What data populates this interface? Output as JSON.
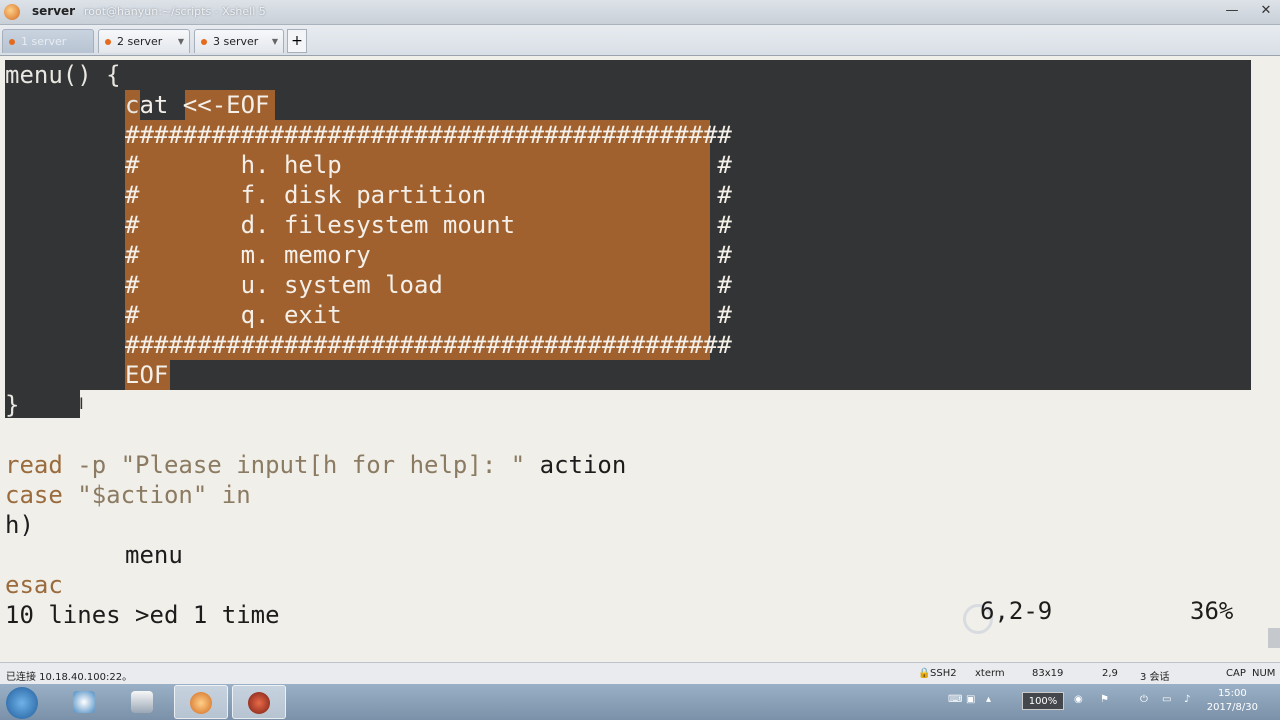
{
  "window": {
    "title": "server",
    "path": "root@hanyun:~/scripts - Xshell 5",
    "minimize_label": "—",
    "maximize_label": "▢",
    "close_label": "✕"
  },
  "tabs": [
    {
      "label": "1 server"
    },
    {
      "label": "2 server"
    },
    {
      "label": "3 server"
    }
  ],
  "tab_add_label": "+",
  "terminal": {
    "line1": "menu() {",
    "line2_c": "c",
    "line2_rest": "at <<-EOF",
    "line3": "##########################################",
    "line4": "#       h. help                          #",
    "line5": "#       f. disk partition                #",
    "line6": "#       d. filesystem mount              #",
    "line7": "#       m. memory                        #",
    "line8": "#       u. system load                   #",
    "line9": "#       q. exit                          #",
    "line10": "##########################################",
    "line11": "EOF",
    "line12": "}",
    "line14_kw": "read",
    "line14_opt": " -p ",
    "line14_str": "\"Please input[h for help]: \"",
    "line14_var": " action",
    "line15_kw": "case",
    "line15_str": " \"$action\"",
    "line15_in": " in",
    "line16": "h)",
    "line17": "menu",
    "line18": "esac",
    "status_msg": "10 lines >ed 1 time",
    "position": "6,2-9",
    "percent": "36%"
  },
  "statusbar": {
    "connection": "已连接 10.18.40.100:22。",
    "protocol": "SSH2",
    "term": "xterm",
    "size": "83x19",
    "cursor": "2,9",
    "sessions": "3 会话",
    "caps": "CAP",
    "num": "NUM"
  },
  "taskbar": {
    "battery": "100%",
    "time": "15:00",
    "date": "2017/8/30"
  },
  "colors": {
    "highlight": "#a0612e",
    "selection_dark": "#333435",
    "terminal_bg": "#f1efe9"
  }
}
